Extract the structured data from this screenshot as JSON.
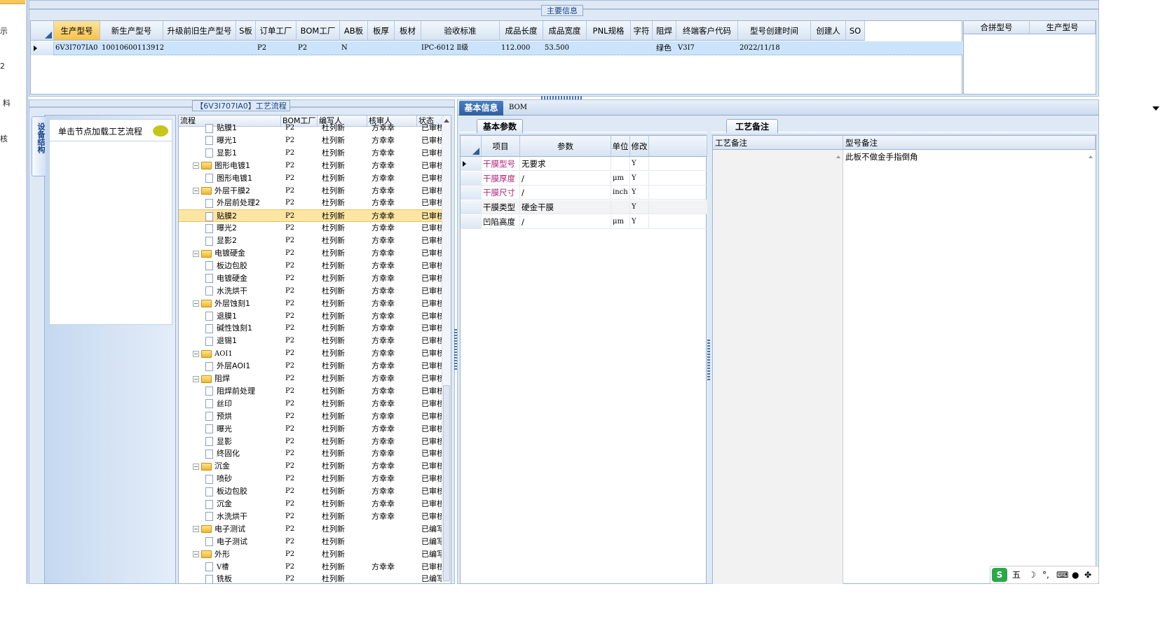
{
  "left_strip": {
    "items": [
      "示",
      "2",
      "料",
      "核"
    ]
  },
  "main_info": {
    "title": "主要信息",
    "columns": [
      "生产型号",
      "新生产型号",
      "升级前旧生产型号",
      "S板",
      "订单工厂",
      "BOM工厂",
      "AB板",
      "板厚",
      "板材",
      "验收标准",
      "成品长度",
      "成品宽度",
      "PNL规格",
      "字符",
      "阻焊",
      "终端客户代码",
      "型号创建时间",
      "创建人",
      "SO"
    ],
    "row": {
      "生产型号": "6V3I707IA0",
      "新生产型号": "10010600113912",
      "订单工厂": "P2",
      "BOM工厂": "P2",
      "AB板": "N",
      "验收标准": "IPC-6012 Ⅱ级",
      "成品长度": "112.000",
      "成品宽度": "53.500",
      "阻焊": "绿色",
      "终端客户代码": "V3I7",
      "型号创建时间": "2022/11/18"
    },
    "side_columns": [
      "合拼型号",
      "生产型号"
    ]
  },
  "process": {
    "title": "【6V3I707IA0】工艺流程",
    "vertical_tab": "设备结构",
    "nav_prompt": "单击节点加载工艺流程",
    "columns": [
      "流程",
      "BOM工厂",
      "编写人",
      "核审人",
      "状态"
    ],
    "rows": [
      {
        "name": "贴膜1",
        "type": "doc",
        "level": 2,
        "bom": "P2",
        "writer": "杜列新",
        "reviewer": "方幸幸",
        "status": "已审核"
      },
      {
        "name": "曝光1",
        "type": "doc",
        "level": 2,
        "bom": "P2",
        "writer": "杜列新",
        "reviewer": "方幸幸",
        "status": "已审核"
      },
      {
        "name": "显影1",
        "type": "doc",
        "level": 2,
        "bom": "P2",
        "writer": "杜列新",
        "reviewer": "方幸幸",
        "status": "已审核"
      },
      {
        "name": "图形电镀1",
        "type": "folder",
        "level": 1,
        "bom": "P2",
        "writer": "杜列新",
        "reviewer": "方幸幸",
        "status": "已审核"
      },
      {
        "name": "图形电镀1",
        "type": "doc",
        "level": 2,
        "bom": "P2",
        "writer": "杜列新",
        "reviewer": "方幸幸",
        "status": "已审核"
      },
      {
        "name": "外层干膜2",
        "type": "folder",
        "level": 1,
        "bom": "P2",
        "writer": "杜列新",
        "reviewer": "方幸幸",
        "status": "已审核"
      },
      {
        "name": "外层前处理2",
        "type": "doc",
        "level": 2,
        "bom": "P2",
        "writer": "杜列新",
        "reviewer": "方幸幸",
        "status": "已审核"
      },
      {
        "name": "贴膜2",
        "type": "doc",
        "level": 2,
        "bom": "P2",
        "writer": "杜列新",
        "reviewer": "方幸幸",
        "status": "已审核",
        "selected": true
      },
      {
        "name": "曝光2",
        "type": "doc",
        "level": 2,
        "bom": "P2",
        "writer": "杜列新",
        "reviewer": "方幸幸",
        "status": "已审核"
      },
      {
        "name": "显影2",
        "type": "doc",
        "level": 2,
        "bom": "P2",
        "writer": "杜列新",
        "reviewer": "方幸幸",
        "status": "已审核"
      },
      {
        "name": "电镀硬金",
        "type": "folder",
        "level": 1,
        "bom": "P2",
        "writer": "杜列新",
        "reviewer": "方幸幸",
        "status": "已审核"
      },
      {
        "name": "板边包胶",
        "type": "doc",
        "level": 2,
        "bom": "P2",
        "writer": "杜列新",
        "reviewer": "方幸幸",
        "status": "已审核"
      },
      {
        "name": "电镀硬金",
        "type": "doc",
        "level": 2,
        "bom": "P2",
        "writer": "杜列新",
        "reviewer": "方幸幸",
        "status": "已审核"
      },
      {
        "name": "水洗烘干",
        "type": "doc",
        "level": 2,
        "bom": "P2",
        "writer": "杜列新",
        "reviewer": "方幸幸",
        "status": "已审核"
      },
      {
        "name": "外层蚀刻1",
        "type": "folder",
        "level": 1,
        "bom": "P2",
        "writer": "杜列新",
        "reviewer": "方幸幸",
        "status": "已审核"
      },
      {
        "name": "退膜1",
        "type": "doc",
        "level": 2,
        "bom": "P2",
        "writer": "杜列新",
        "reviewer": "方幸幸",
        "status": "已审核"
      },
      {
        "name": "碱性蚀刻1",
        "type": "doc",
        "level": 2,
        "bom": "P2",
        "writer": "杜列新",
        "reviewer": "方幸幸",
        "status": "已审核"
      },
      {
        "name": "退锡1",
        "type": "doc",
        "level": 2,
        "bom": "P2",
        "writer": "杜列新",
        "reviewer": "方幸幸",
        "status": "已审核"
      },
      {
        "name": "AOI1",
        "type": "folder",
        "level": 1,
        "bom": "P2",
        "writer": "杜列新",
        "reviewer": "方幸幸",
        "status": "已审核"
      },
      {
        "name": "外层AOI1",
        "type": "doc",
        "level": 2,
        "bom": "P2",
        "writer": "杜列新",
        "reviewer": "方幸幸",
        "status": "已审核"
      },
      {
        "name": "阻焊",
        "type": "folder",
        "level": 1,
        "bom": "P2",
        "writer": "杜列新",
        "reviewer": "方幸幸",
        "status": "已审核"
      },
      {
        "name": "阻焊前处理",
        "type": "doc",
        "level": 2,
        "bom": "P2",
        "writer": "杜列新",
        "reviewer": "方幸幸",
        "status": "已审核"
      },
      {
        "name": "丝印",
        "type": "doc",
        "level": 2,
        "bom": "P2",
        "writer": "杜列新",
        "reviewer": "方幸幸",
        "status": "已审核"
      },
      {
        "name": "预烘",
        "type": "doc",
        "level": 2,
        "bom": "P2",
        "writer": "杜列新",
        "reviewer": "方幸幸",
        "status": "已审核"
      },
      {
        "name": "曝光",
        "type": "doc",
        "level": 2,
        "bom": "P2",
        "writer": "杜列新",
        "reviewer": "方幸幸",
        "status": "已审核"
      },
      {
        "name": "显影",
        "type": "doc",
        "level": 2,
        "bom": "P2",
        "writer": "杜列新",
        "reviewer": "方幸幸",
        "status": "已审核"
      },
      {
        "name": "终固化",
        "type": "doc",
        "level": 2,
        "bom": "P2",
        "writer": "杜列新",
        "reviewer": "方幸幸",
        "status": "已审核"
      },
      {
        "name": "沉金",
        "type": "folder",
        "level": 1,
        "bom": "P2",
        "writer": "杜列新",
        "reviewer": "方幸幸",
        "status": "已审核"
      },
      {
        "name": "喷砂",
        "type": "doc",
        "level": 2,
        "bom": "P2",
        "writer": "杜列新",
        "reviewer": "方幸幸",
        "status": "已审核"
      },
      {
        "name": "板边包胶",
        "type": "doc",
        "level": 2,
        "bom": "P2",
        "writer": "杜列新",
        "reviewer": "方幸幸",
        "status": "已审核"
      },
      {
        "name": "沉金",
        "type": "doc",
        "level": 2,
        "bom": "P2",
        "writer": "杜列新",
        "reviewer": "方幸幸",
        "status": "已审核"
      },
      {
        "name": "水洗烘干",
        "type": "doc",
        "level": 2,
        "bom": "P2",
        "writer": "杜列新",
        "reviewer": "方幸幸",
        "status": "已审核"
      },
      {
        "name": "电子测试",
        "type": "folder",
        "level": 1,
        "bom": "P2",
        "writer": "杜列新",
        "reviewer": "",
        "status": "已编写"
      },
      {
        "name": "电子测试",
        "type": "doc",
        "level": 2,
        "bom": "P2",
        "writer": "杜列新",
        "reviewer": "",
        "status": "已编写"
      },
      {
        "name": "外形",
        "type": "folder",
        "level": 1,
        "bom": "P2",
        "writer": "杜列新",
        "reviewer": "",
        "status": "已编写"
      },
      {
        "name": "V槽",
        "type": "doc",
        "level": 2,
        "bom": "P2",
        "writer": "杜列新",
        "reviewer": "方幸幸",
        "status": "已审核"
      },
      {
        "name": "铣板",
        "type": "doc",
        "level": 2,
        "bom": "P2",
        "writer": "杜列新",
        "reviewer": "",
        "status": "已编写"
      }
    ]
  },
  "details": {
    "tabs": [
      "基本信息",
      "BOM"
    ],
    "subtab": "基本参数",
    "param_columns": [
      "项目",
      "参数",
      "单位",
      "修改"
    ],
    "params": [
      {
        "item": "干膜型号",
        "value": "无要求",
        "unit": "",
        "mod": "Y",
        "highlight": true
      },
      {
        "item": "干膜厚度",
        "value": "/",
        "unit": "μm",
        "mod": "Y",
        "highlight": true
      },
      {
        "item": "干膜尺寸",
        "value": "/",
        "unit": "inch",
        "mod": "Y",
        "highlight": true
      },
      {
        "item": "干膜类型",
        "value": "硬金干膜",
        "unit": "",
        "mod": "Y",
        "highlight": false
      },
      {
        "item": "凹陷高度",
        "value": "/",
        "unit": "μm",
        "mod": "Y",
        "highlight": false
      }
    ],
    "notes_tab": "工艺备注",
    "notes_columns": [
      "工艺备注",
      "型号备注"
    ],
    "model_note": "此板不做金手指倒角",
    "highlight_color": "#b0237a"
  },
  "ime": {
    "label": "五"
  }
}
